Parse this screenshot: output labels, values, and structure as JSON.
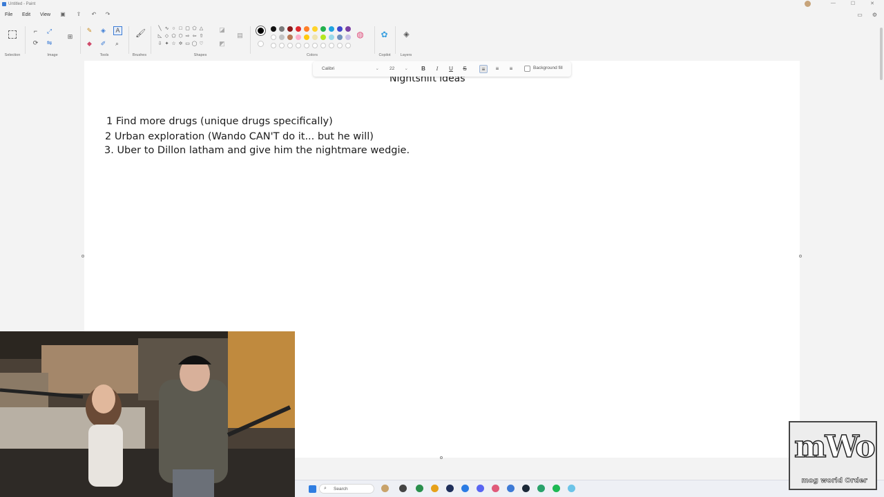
{
  "window": {
    "title": "Untitled - Paint",
    "controls": [
      "—",
      "☐",
      "✕"
    ]
  },
  "menu": {
    "file": "File",
    "edit": "Edit",
    "view": "View"
  },
  "ribbon": {
    "groups": {
      "selection": "Selection",
      "image": "Image",
      "tools": "Tools",
      "brushes": "Brushes",
      "shapes": "Shapes",
      "colors": "Colors",
      "copilot": "Copilot",
      "layers": "Layers"
    },
    "palette_row1": [
      "#111111",
      "#7a7a7a",
      "#8b1a1a",
      "#e0282e",
      "#ff7f27",
      "#ffd42a",
      "#22b14c",
      "#1fa3e0",
      "#3f48cc",
      "#7a3fa3"
    ],
    "palette_row2": [
      "#ffffff",
      "#c3c3c3",
      "#b97a57",
      "#ffaec9",
      "#ffc90e",
      "#efe4b0",
      "#b5e61d",
      "#99d9ea",
      "#7092be",
      "#c8bfe7"
    ],
    "active_color": "#000000"
  },
  "format_bar": {
    "font": "Calibri",
    "size": "22",
    "bold": "B",
    "italic": "I",
    "underline": "U",
    "strike": "S",
    "background_fill": "Background fill"
  },
  "document": {
    "title": "Nightshift ideas",
    "lines": [
      "1 Find more drugs (unique drugs specifically)",
      "2 Urban exploration (Wando CAN'T do it... but he will)",
      "3. Uber to Dillon latham and give him the nightmare wedgie."
    ]
  },
  "taskbar": {
    "search_placeholder": "Search"
  },
  "overlay": {
    "logo_main": "mWo",
    "logo_sub": "mog world Order"
  }
}
